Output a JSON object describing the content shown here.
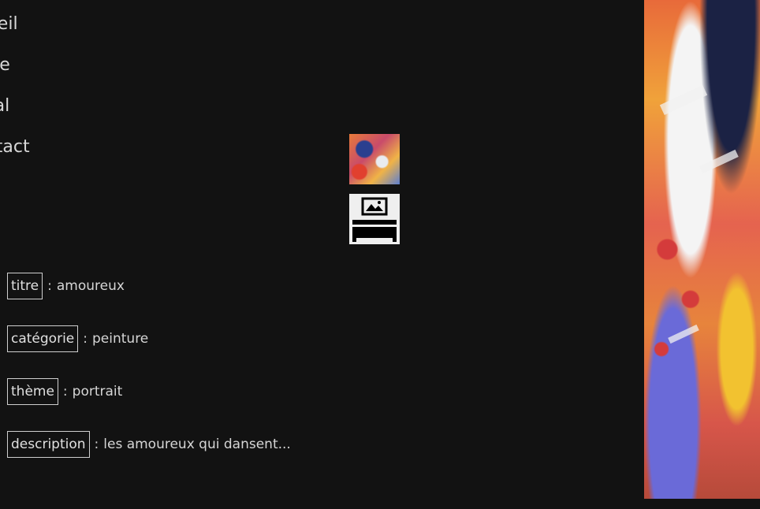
{
  "nav": {
    "items": [
      {
        "label": "Accueil"
      },
      {
        "label": "Peinture"
      },
      {
        "label": "Spécial"
      },
      {
        "label": "Contact"
      }
    ]
  },
  "thumbnails": [
    {
      "icon": "painting-thumbnail"
    },
    {
      "icon": "sofa-frame-icon"
    }
  ],
  "fields": [
    {
      "label": "titre",
      "value": "amoureux"
    },
    {
      "label": "catégorie",
      "value": "peinture"
    },
    {
      "label": "thème",
      "value": "portrait"
    },
    {
      "label": "description",
      "value": "les amoureux qui dansent..."
    }
  ],
  "separator": ":",
  "colors": {
    "background": "#121212",
    "text": "#d6d6d6",
    "border": "#cfcfcf"
  }
}
